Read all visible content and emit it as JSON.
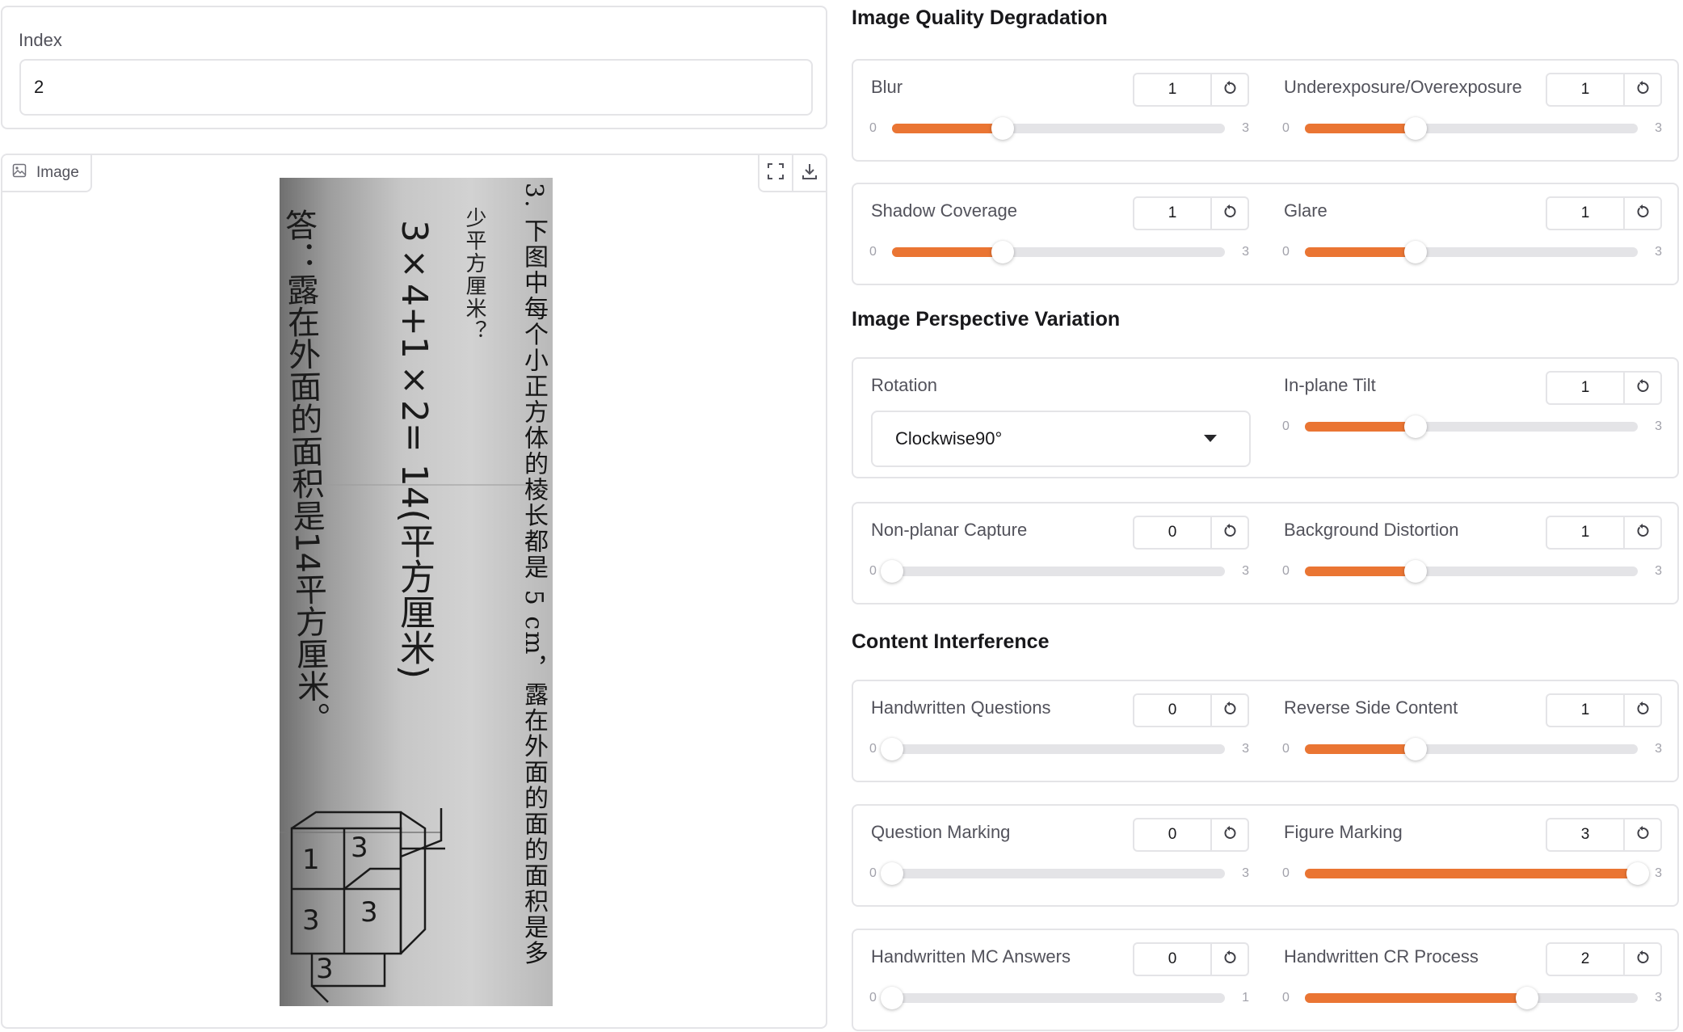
{
  "index": {
    "label": "Index",
    "value": "2"
  },
  "image_panel": {
    "tab_label": "Image",
    "icons": [
      "image-icon",
      "fullscreen-icon",
      "download-icon"
    ],
    "photo_text": {
      "question_line1": "3. 下图中每个小正方体的棱长都是 5 cm，露在外面的面的面积是多",
      "question_line2": "少平方厘米？",
      "handwritten_line1": "3×4+1×2= 14(平方厘米)",
      "handwritten_line2": "答：露在外面的面积是14平方厘米。",
      "figure_labels": [
        "1",
        "3",
        "3",
        "3",
        "3"
      ]
    }
  },
  "sections": [
    {
      "title": "Image Quality Degradation",
      "rows": [
        [
          {
            "label": "Blur",
            "value": "1",
            "min": "0",
            "max": "3",
            "fraction": 0.333
          },
          {
            "label": "Underexposure/Overexposure",
            "value": "1",
            "min": "0",
            "max": "3",
            "fraction": 0.333
          }
        ],
        [
          {
            "label": "Shadow Coverage",
            "value": "1",
            "min": "0",
            "max": "3",
            "fraction": 0.333
          },
          {
            "label": "Glare",
            "value": "1",
            "min": "0",
            "max": "3",
            "fraction": 0.333
          }
        ]
      ]
    },
    {
      "title": "Image Perspective Variation",
      "rows": [
        [
          {
            "label": "Rotation",
            "type": "dropdown",
            "value": "Clockwise90°"
          },
          {
            "label": "In-plane Tilt",
            "value": "1",
            "min": "0",
            "max": "3",
            "fraction": 0.333
          }
        ],
        [
          {
            "label": "Non-planar Capture",
            "value": "0",
            "min": "0",
            "max": "3",
            "fraction": 0
          },
          {
            "label": "Background Distortion",
            "value": "1",
            "min": "0",
            "max": "3",
            "fraction": 0.333
          }
        ]
      ]
    },
    {
      "title": "Content Interference",
      "rows": [
        [
          {
            "label": "Handwritten Questions",
            "value": "0",
            "min": "0",
            "max": "3",
            "fraction": 0
          },
          {
            "label": "Reverse Side Content",
            "value": "1",
            "min": "0",
            "max": "3",
            "fraction": 0.333
          }
        ],
        [
          {
            "label": "Question Marking",
            "value": "0",
            "min": "0",
            "max": "3",
            "fraction": 0
          },
          {
            "label": "Figure Marking",
            "value": "3",
            "min": "0",
            "max": "3",
            "fraction": 1
          }
        ],
        [
          {
            "label": "Handwritten MC Answers",
            "value": "0",
            "min": "0",
            "max": "1",
            "fraction": 0
          },
          {
            "label": "Handwritten CR Process",
            "value": "2",
            "min": "0",
            "max": "3",
            "fraction": 0.667
          }
        ]
      ]
    }
  ],
  "colors": {
    "accent": "#ea7533",
    "border": "#e4e4e7",
    "track": "#e4e4e7"
  }
}
